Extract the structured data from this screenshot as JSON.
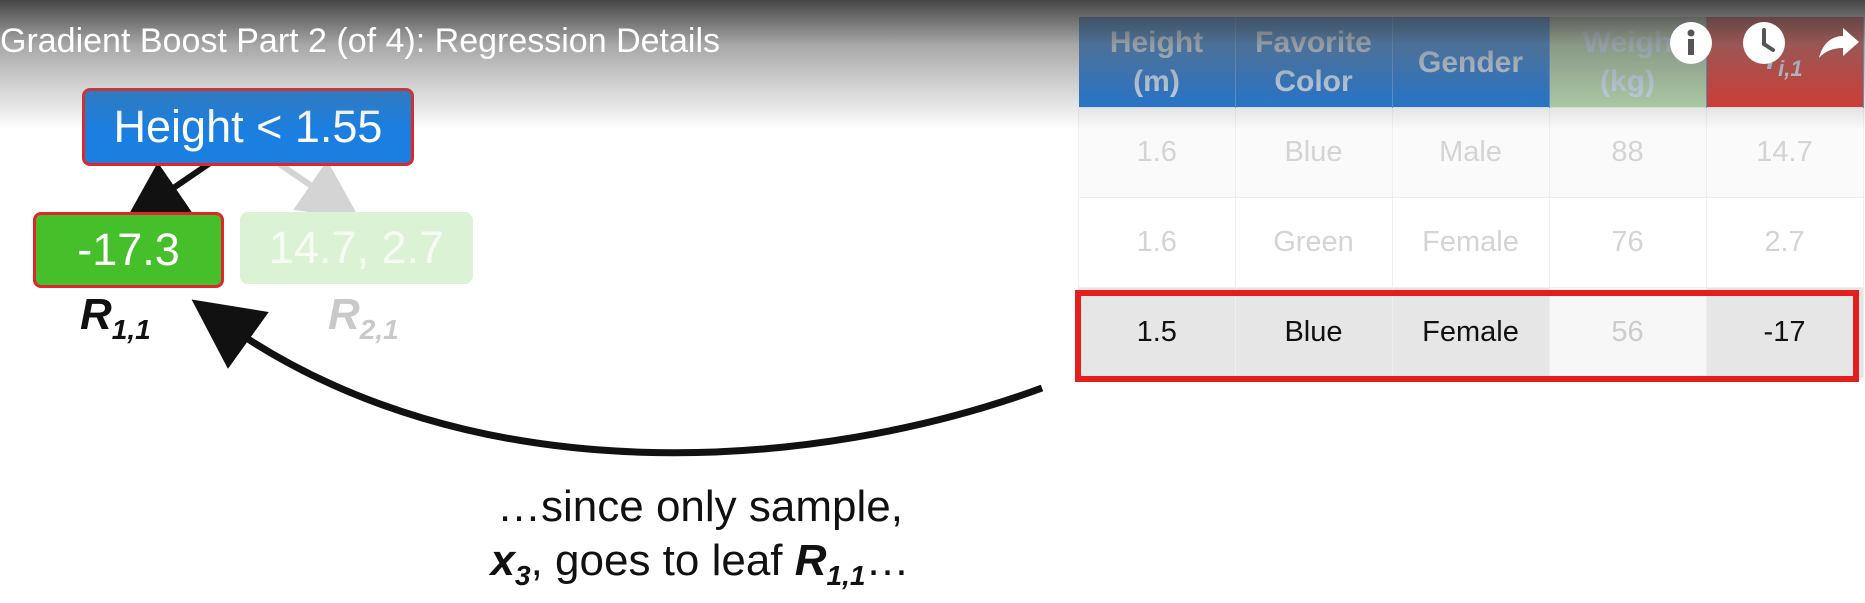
{
  "video": {
    "title": "Gradient Boost Part 2 (of 4): Regression Details"
  },
  "controls": [
    {
      "name": "info-icon"
    },
    {
      "name": "clock-icon"
    },
    {
      "name": "share-icon"
    }
  ],
  "tree": {
    "root_label": "Height < 1.55",
    "leaf_left_value": "-17.3",
    "leaf_right_value": "14.7, 2.7",
    "leaf_left_name": "R",
    "leaf_left_sub": "1,1",
    "leaf_right_name": "R",
    "leaf_right_sub": "2,1"
  },
  "table": {
    "headers": [
      {
        "l1": "Height",
        "l2": "(m)"
      },
      {
        "l1": "Favorite",
        "l2": "Color"
      },
      {
        "l1": "Gender",
        "l2": ""
      },
      {
        "l1": "Weigh",
        "l2": "(kg)"
      },
      {
        "l1": "r",
        "l2": "i,1"
      }
    ],
    "rows": [
      [
        "1.6",
        "Blue",
        "Male",
        "88",
        "14.7"
      ],
      [
        "1.6",
        "Green",
        "Female",
        "76",
        "2.7"
      ],
      [
        "1.5",
        "Blue",
        "Female",
        "56",
        "-17"
      ]
    ]
  },
  "caption": {
    "line1": "…since only sample,",
    "line2_var": "x",
    "line2_var_sub": "3",
    "line2_mid": ", goes to leaf ",
    "line2_leaf": "R",
    "line2_leaf_sub": "1,1",
    "line2_end": "…"
  },
  "colors": {
    "header_blue": "#1a75d8",
    "header_green": "#b5d9ad",
    "header_red": "#df342d",
    "highlight_red": "#e41d1d",
    "leaf_green": "#46c02a"
  }
}
